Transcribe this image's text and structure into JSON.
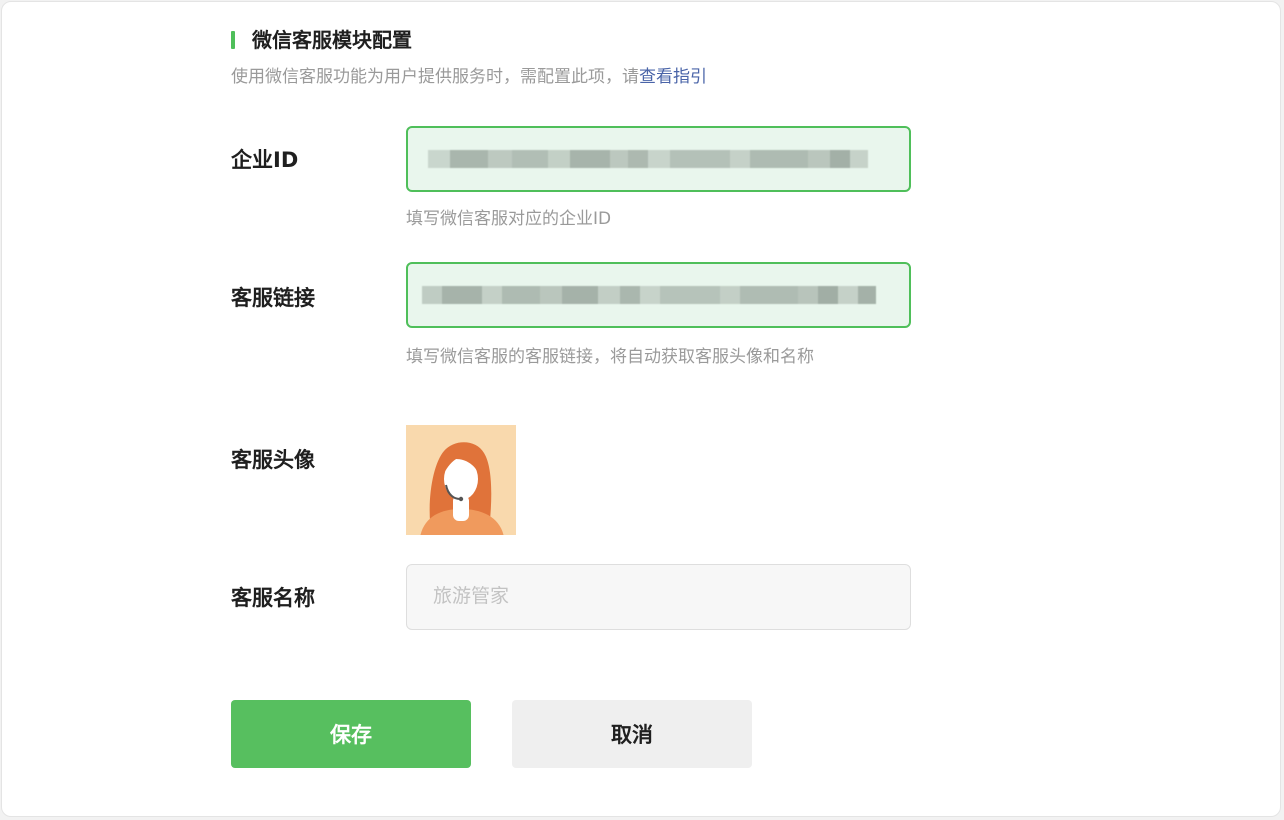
{
  "section": {
    "title": "微信客服模块配置",
    "description": "使用微信客服功能为用户提供服务时，需配置此项，请",
    "guide_link": "查看指引"
  },
  "fields": {
    "corp_id": {
      "label": "企业ID",
      "hint": "填写微信客服对应的企业ID"
    },
    "service_link": {
      "label": "客服链接",
      "hint": "填写微信客服的客服链接，将自动获取客服头像和名称"
    },
    "avatar": {
      "label": "客服头像",
      "icon": "customer-service-avatar-icon"
    },
    "service_name": {
      "label": "客服名称",
      "placeholder": "旅游管家"
    }
  },
  "buttons": {
    "save": "保存",
    "cancel": "取消"
  },
  "colors": {
    "accent": "#57bf5f",
    "link": "#4a64a8",
    "active_field_bg": "#e9f6ed"
  }
}
